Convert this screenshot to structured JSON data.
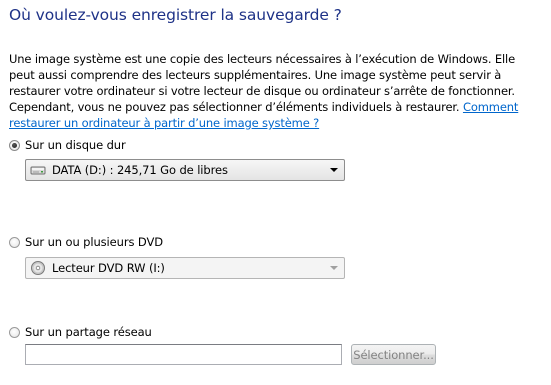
{
  "header": {
    "title": "Où voulez-vous enregistrer la sauvegarde ?"
  },
  "description": {
    "text": "Une image système est une copie des lecteurs nécessaires à l’exécution de Windows. Elle peut aussi comprendre des lecteurs supplémentaires. Une image système peut servir à restaurer votre ordinateur si votre lecteur de disque ou ordinateur s’arrête de fonctionner. Cependant, vous ne pouvez pas sélectionner d’éléments individuels à restaurer.",
    "link_text": "Comment restaurer un ordinateur à partir d’une image système ?"
  },
  "options": {
    "hard_disk": {
      "label": "Sur un disque dur",
      "selected": true,
      "dropdown_value": "DATA (D:) : 245,71 Go de libres",
      "dropdown_icon": "hard-drive-icon"
    },
    "dvd": {
      "label": "Sur un ou plusieurs DVD",
      "selected": false,
      "dropdown_value": "Lecteur DVD RW (I:)",
      "dropdown_icon": "dvd-drive-icon"
    },
    "network": {
      "label": "Sur un partage réseau",
      "selected": false,
      "path_value": "",
      "select_button": "Sélectionner..."
    }
  },
  "colors": {
    "title": "#1e3287",
    "link": "#0066cc",
    "disabled_text": "#838383"
  }
}
